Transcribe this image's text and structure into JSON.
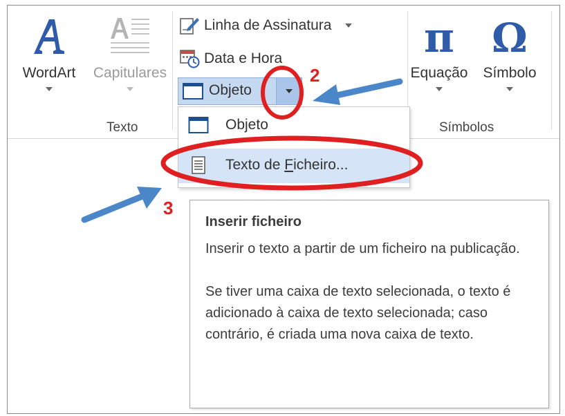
{
  "ribbon": {
    "texto_group": {
      "label": "Texto",
      "wordart_label": "WordArt",
      "capitulares_label": "Capitulares"
    },
    "insert_group": {
      "linha_assinatura_label": "Linha de Assinatura",
      "data_hora_label": "Data e Hora",
      "objeto_label": "Objeto"
    },
    "simbolos_group": {
      "label": "Símbolos",
      "equacao_label": "Equação",
      "simbolo_label": "Símbolo",
      "pi_glyph": "π",
      "omega_glyph": "Ω"
    }
  },
  "dropdown": {
    "items": [
      {
        "label": "Objeto",
        "icon": "object-icon"
      },
      {
        "label_prefix": "Texto de ",
        "label_accel": "F",
        "label_suffix": "icheiro...",
        "icon": "text-file-icon"
      }
    ]
  },
  "tooltip": {
    "title": "Inserir ficheiro",
    "para1": "Inserir o texto a partir de um ficheiro na publicação.",
    "para2": "Se tiver uma caixa de texto selecionada, o texto é adicionado à caixa de texto selecionada; caso contrário, é criada uma nova caixa de texto."
  },
  "annotations": {
    "step2": "2",
    "step3": "3",
    "circle_color": "#e02020",
    "arrow_color": "#4a86c8"
  },
  "colors": {
    "accent_blue": "#1f4e8c",
    "hover_bg": "#d5e4f6"
  }
}
